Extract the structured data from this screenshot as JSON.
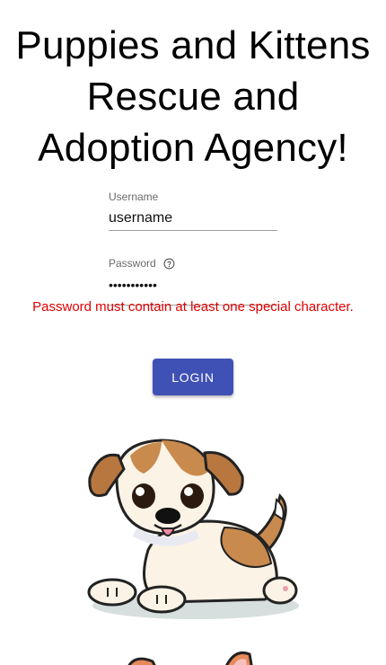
{
  "header": {
    "title_line1": "Puppies and Kittens",
    "title_line2": "Rescue and",
    "title_line3": "Adoption Agency!"
  },
  "form": {
    "username": {
      "label": "Username",
      "value": "username"
    },
    "password": {
      "label": "Password",
      "masked_value": "•••••••••••",
      "help_icon": "help-circle-icon"
    },
    "error_message": "Password must contain at least one special character.",
    "login_label": "LOGIN"
  },
  "images": {
    "puppy": "cartoon-puppy",
    "kitten": "cartoon-kitten"
  },
  "colors": {
    "primary": "#3f51b5",
    "error": "#e00000",
    "underline": "#9e9e9e"
  }
}
